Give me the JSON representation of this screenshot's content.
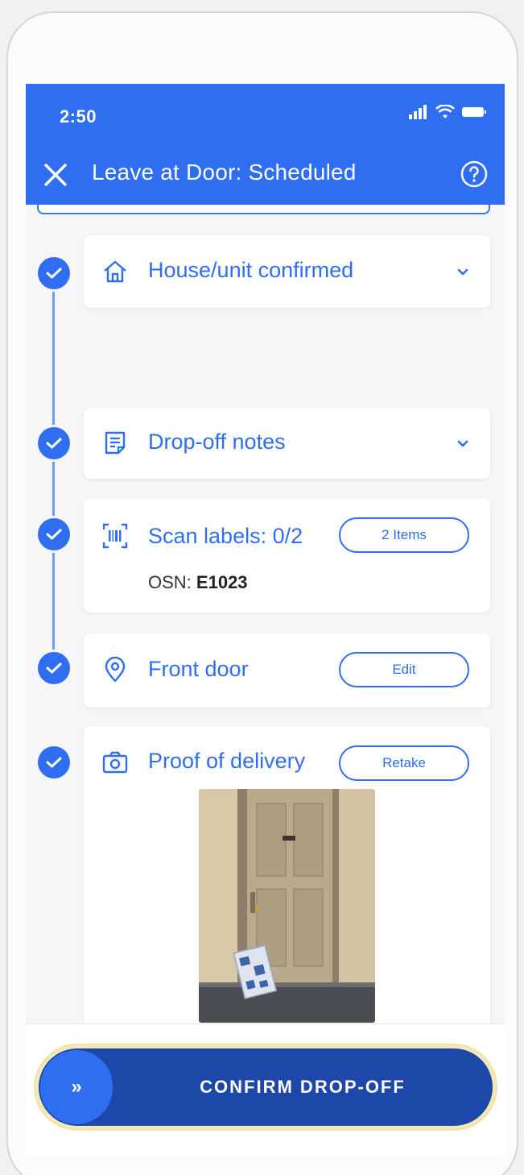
{
  "status_bar": {
    "time": "2:50"
  },
  "header": {
    "title": "Leave at Door: Scheduled"
  },
  "steps": [
    {
      "label": "House/unit confirmed",
      "icon": "home-icon",
      "completed": true
    },
    {
      "label": "Drop-off notes",
      "icon": "notes-icon",
      "completed": true
    },
    {
      "label": "Scan labels: 0/2",
      "icon": "barcode-scan-icon",
      "completed": true,
      "button": "2 Items",
      "osn_label": "OSN:",
      "osn_value": "E1023"
    },
    {
      "label": "Front door",
      "icon": "location-pin-icon",
      "completed": true,
      "button": "Edit"
    },
    {
      "label": "Proof of delivery",
      "icon": "camera-icon",
      "completed": true,
      "button": "Retake"
    }
  ],
  "footer": {
    "confirm_label": "CONFIRM DROP-OFF",
    "knob_glyph": "»"
  },
  "colors": {
    "primary": "#2f6ef0",
    "confirm": "#1d47a8"
  }
}
